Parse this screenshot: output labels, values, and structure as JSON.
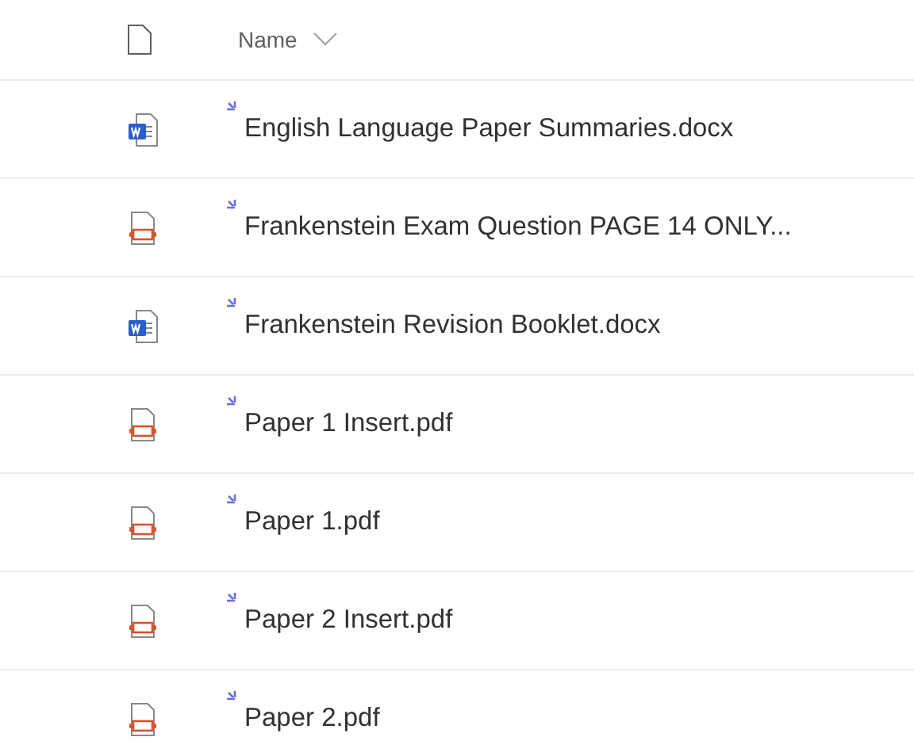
{
  "header": {
    "column_label": "Name"
  },
  "files": [
    {
      "name": "English Language Paper Summaries.docx",
      "kind": "word",
      "new": true
    },
    {
      "name": "Frankenstein Exam Question PAGE 14 ONLY...",
      "kind": "pdf",
      "new": true
    },
    {
      "name": "Frankenstein Revision Booklet.docx",
      "kind": "word",
      "new": true
    },
    {
      "name": "Paper 1 Insert.pdf",
      "kind": "pdf",
      "new": true
    },
    {
      "name": "Paper 1.pdf",
      "kind": "pdf",
      "new": true
    },
    {
      "name": "Paper 2 Insert.pdf",
      "kind": "pdf",
      "new": true
    },
    {
      "name": "Paper 2.pdf",
      "kind": "pdf",
      "new": true
    }
  ]
}
